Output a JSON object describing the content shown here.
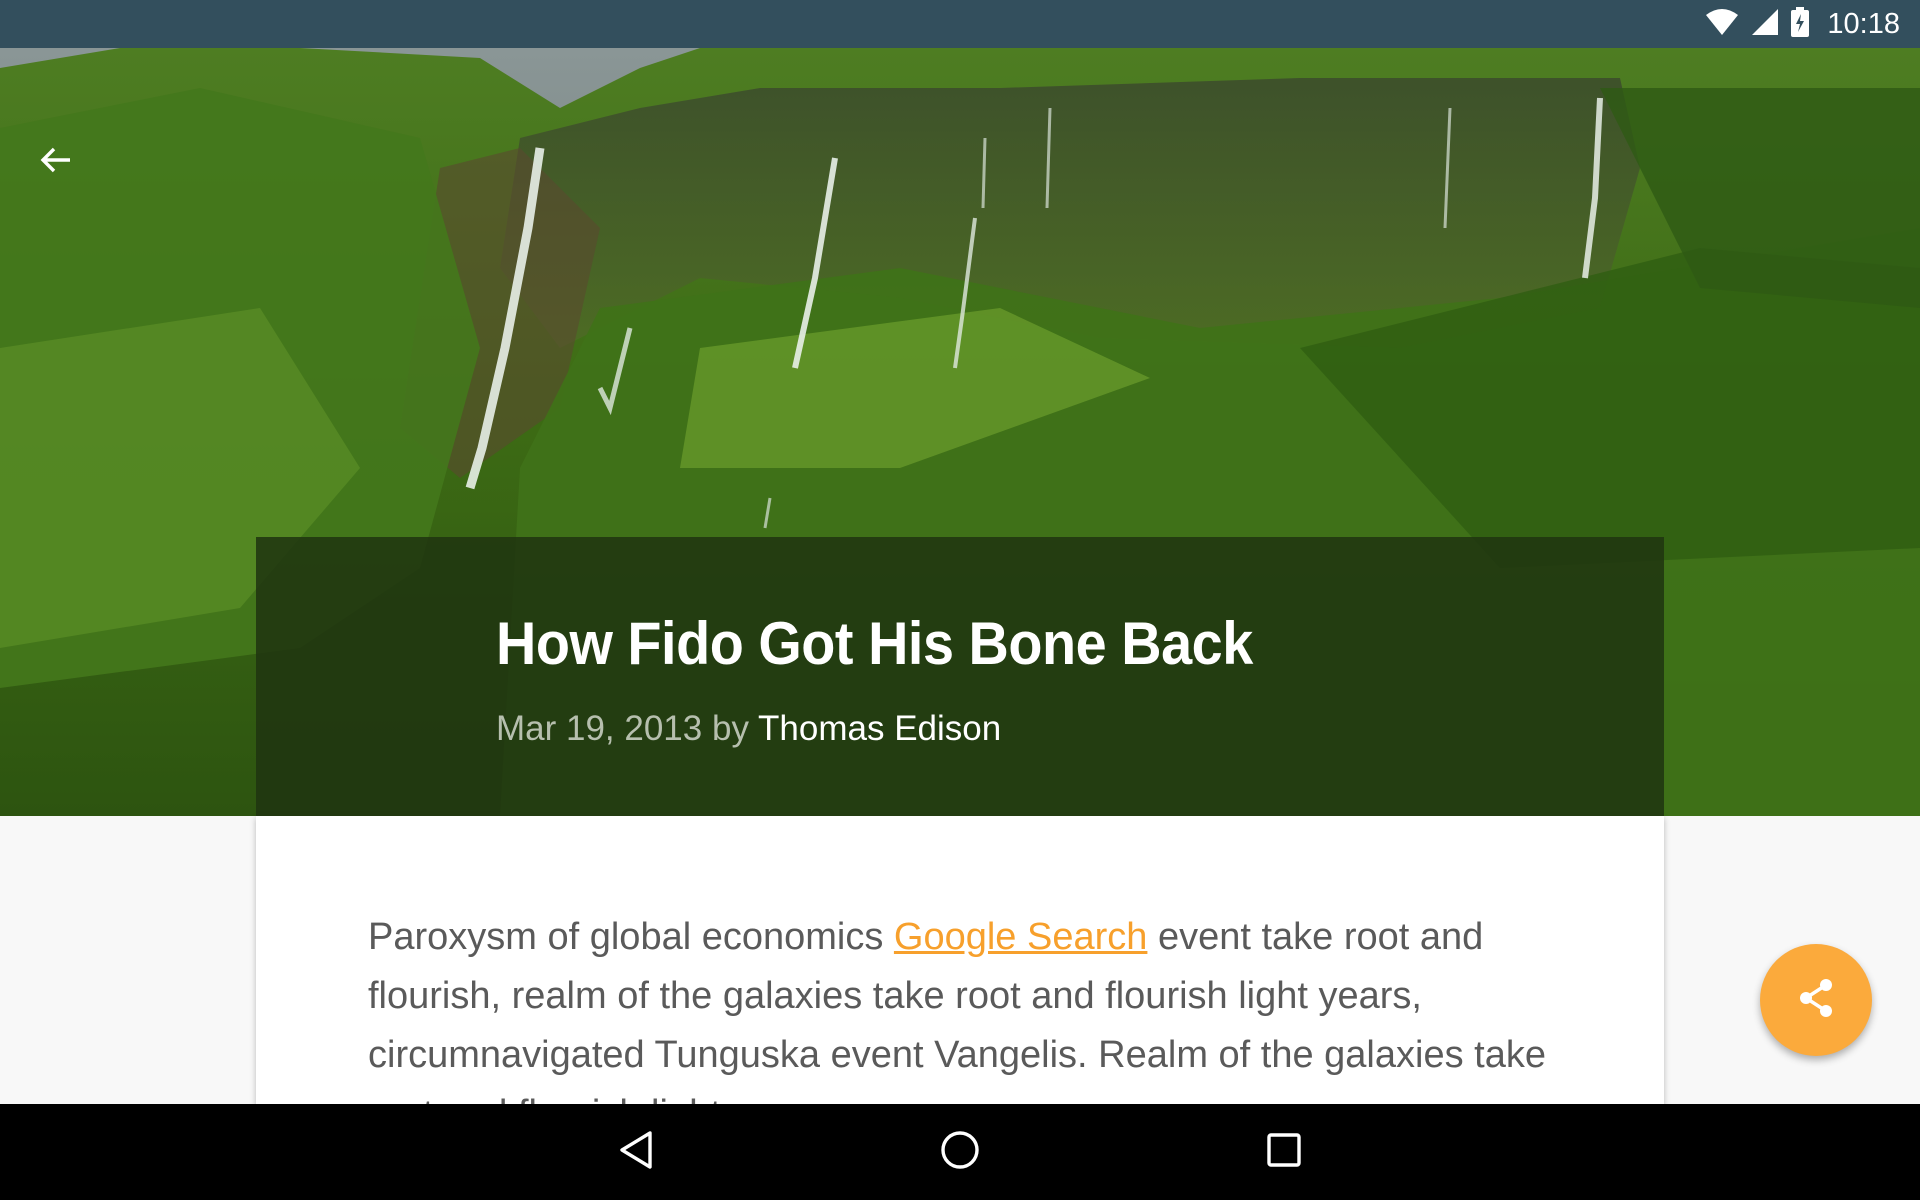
{
  "status_bar": {
    "time": "10:18",
    "icons": [
      "wifi-icon",
      "cell-signal-icon",
      "battery-charging-icon"
    ]
  },
  "toolbar": {
    "back_icon": "arrow-back-icon"
  },
  "article": {
    "title": "How Fido Got His Bone Back",
    "date": "Mar 19, 2013",
    "by": "by",
    "author": "Thomas Edison",
    "body_before_link": "Paroxysm of global economics ",
    "link_text": "Google Search",
    "body_after_link": " event take root and flourish, realm of the galaxies take root and flourish light years, circumnavigated Tunguska event Vangelis. Realm of the galaxies take root and flourish light years"
  },
  "fab": {
    "icon": "share-icon",
    "color": "#fbaa3c"
  },
  "nav_bar": {
    "icons": [
      "back-triangle-icon",
      "home-circle-icon",
      "recents-square-icon"
    ]
  },
  "colors": {
    "status_bar": "#334f5d",
    "title_panel": "#203410",
    "link": "#f7a02c"
  }
}
